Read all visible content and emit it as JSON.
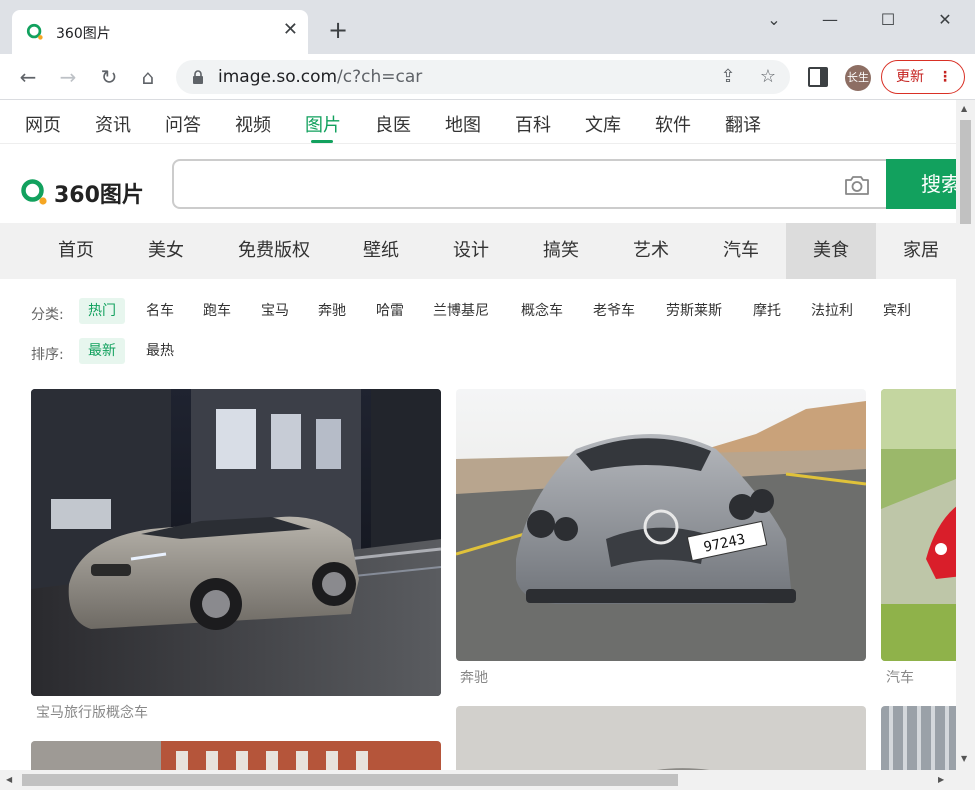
{
  "browser": {
    "tab_title": "360图片",
    "url_host": "image.so.com",
    "url_path": "/c?ch=car",
    "profile_initials": "长生",
    "update_label": "更新",
    "icons": [
      "back-icon",
      "forward-icon",
      "reload-icon",
      "home-icon",
      "lock-icon",
      "share-icon",
      "star-icon",
      "side-panel-icon",
      "more-icon"
    ]
  },
  "topnav": {
    "items": [
      "网页",
      "资讯",
      "问答",
      "视频",
      "图片",
      "良医",
      "地图",
      "百科",
      "文库",
      "软件",
      "翻译"
    ],
    "active": "图片"
  },
  "logo": {
    "text": "360图片"
  },
  "search": {
    "value": "",
    "button_label": "搜索"
  },
  "categories": {
    "items": [
      "首页",
      "美女",
      "免费版权",
      "壁纸",
      "设计",
      "搞笑",
      "艺术",
      "汽车",
      "美食",
      "家居"
    ],
    "active": "美食"
  },
  "filters": {
    "type_label": "分类:",
    "types": [
      "热门",
      "名车",
      "跑车",
      "宝马",
      "奔驰",
      "哈雷",
      "兰博基尼",
      "概念车",
      "老爷车",
      "劳斯莱斯",
      "摩托",
      "法拉利",
      "宾利"
    ],
    "type_active": "热门",
    "sort_label": "排序:",
    "sorts": [
      "最新",
      "最热"
    ],
    "sort_active": "最新"
  },
  "images": [
    {
      "caption": "宝马旅行版概念车",
      "subject": "silver BMW concept car in city street at night"
    },
    {
      "caption": "奔驰",
      "subject": "silver Mercedes SLR on road",
      "plate": "97243"
    },
    {
      "caption": "汽车",
      "subject": "red sports car on green background"
    }
  ],
  "colors": {
    "accent": "#12a15e",
    "update_red": "#c5221f"
  }
}
